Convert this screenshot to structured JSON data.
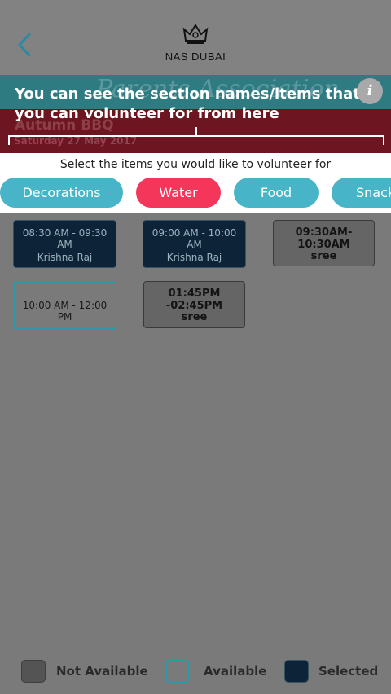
{
  "header": {
    "brand": "NAS DUBAI",
    "back_icon": "chevron-left-icon",
    "logo_icon": "crown-logo-icon"
  },
  "tooltip": {
    "text": "You can see the section names/items that  you can volunteer for from here",
    "watermark": "Parents Association",
    "info_icon": "info-icon",
    "info_glyph": "i"
  },
  "event": {
    "title": "Autumn BBQ",
    "date": "Saturday 27 May 2017"
  },
  "chooser": {
    "title": "Select the items you would like to volunteer for",
    "items": [
      {
        "label": "Decorations",
        "active": false
      },
      {
        "label": "Water",
        "active": true
      },
      {
        "label": "Food",
        "active": false
      },
      {
        "label": "Snacks",
        "active": false
      }
    ]
  },
  "slots": [
    {
      "time": "08:30 AM - 09:30 AM",
      "name": "Krishna Raj",
      "status": "Selected"
    },
    {
      "time": "09:00 AM - 10:00 AM",
      "name": "Krishna Raj",
      "status": "Selected"
    },
    {
      "time": "09:30AM-10:30AM",
      "name": "sree",
      "status": "Not Available"
    },
    {
      "time": "10:00 AM - 12:00 PM",
      "name": "",
      "status": "Available"
    },
    {
      "time": "01:45PM -02:45PM",
      "name": "sree",
      "status": "Not Available"
    }
  ],
  "legend": {
    "not_available": "Not Available",
    "available": "Available",
    "selected": "Selected"
  },
  "colors": {
    "teal": "#2f7b82",
    "maroon": "#6d1520",
    "pill_blue": "#47b5c7",
    "pill_active": "#f4365a",
    "selected": "#0d2438",
    "unavailable": "#656565",
    "available_border": "#2d9aa8"
  }
}
